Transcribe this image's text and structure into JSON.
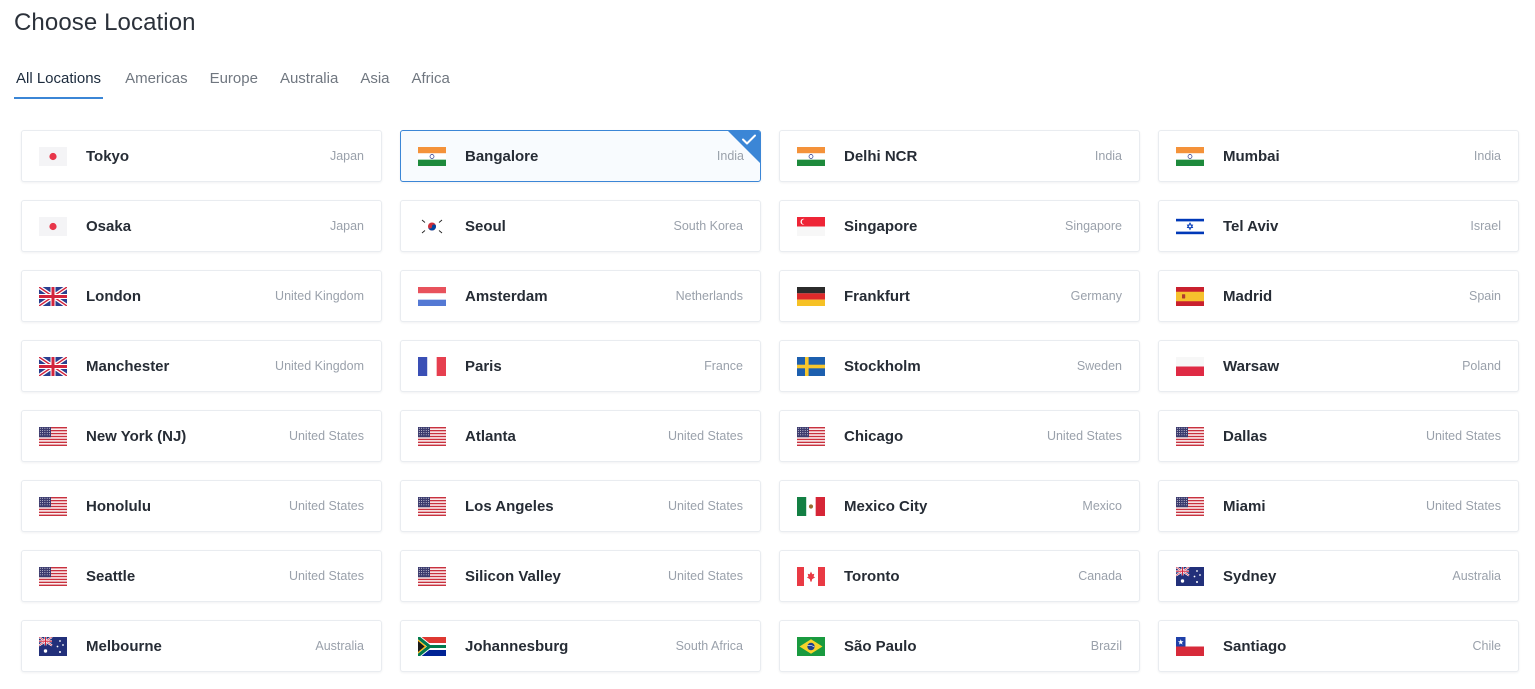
{
  "title": "Choose Location",
  "tabs": [
    {
      "label": "All Locations",
      "active": true
    },
    {
      "label": "Americas",
      "active": false
    },
    {
      "label": "Europe",
      "active": false
    },
    {
      "label": "Australia",
      "active": false
    },
    {
      "label": "Asia",
      "active": false
    },
    {
      "label": "Africa",
      "active": false
    }
  ],
  "selected_city": "Bangalore",
  "accent_color": "#3b86d6",
  "locations": [
    {
      "city": "Tokyo",
      "country": "Japan",
      "flag": "japan-flag-icon"
    },
    {
      "city": "Bangalore",
      "country": "India",
      "flag": "india-flag-icon"
    },
    {
      "city": "Delhi NCR",
      "country": "India",
      "flag": "india-flag-icon"
    },
    {
      "city": "Mumbai",
      "country": "India",
      "flag": "india-flag-icon"
    },
    {
      "city": "Osaka",
      "country": "Japan",
      "flag": "japan-flag-icon"
    },
    {
      "city": "Seoul",
      "country": "South Korea",
      "flag": "south-korea-flag-icon"
    },
    {
      "city": "Singapore",
      "country": "Singapore",
      "flag": "singapore-flag-icon"
    },
    {
      "city": "Tel Aviv",
      "country": "Israel",
      "flag": "israel-flag-icon"
    },
    {
      "city": "London",
      "country": "United Kingdom",
      "flag": "uk-flag-icon"
    },
    {
      "city": "Amsterdam",
      "country": "Netherlands",
      "flag": "netherlands-flag-icon"
    },
    {
      "city": "Frankfurt",
      "country": "Germany",
      "flag": "germany-flag-icon"
    },
    {
      "city": "Madrid",
      "country": "Spain",
      "flag": "spain-flag-icon"
    },
    {
      "city": "Manchester",
      "country": "United Kingdom",
      "flag": "uk-flag-icon"
    },
    {
      "city": "Paris",
      "country": "France",
      "flag": "france-flag-icon"
    },
    {
      "city": "Stockholm",
      "country": "Sweden",
      "flag": "sweden-flag-icon"
    },
    {
      "city": "Warsaw",
      "country": "Poland",
      "flag": "poland-flag-icon"
    },
    {
      "city": "New York (NJ)",
      "country": "United States",
      "flag": "us-flag-icon"
    },
    {
      "city": "Atlanta",
      "country": "United States",
      "flag": "us-flag-icon"
    },
    {
      "city": "Chicago",
      "country": "United States",
      "flag": "us-flag-icon"
    },
    {
      "city": "Dallas",
      "country": "United States",
      "flag": "us-flag-icon"
    },
    {
      "city": "Honolulu",
      "country": "United States",
      "flag": "us-flag-icon"
    },
    {
      "city": "Los Angeles",
      "country": "United States",
      "flag": "us-flag-icon"
    },
    {
      "city": "Mexico City",
      "country": "Mexico",
      "flag": "mexico-flag-icon"
    },
    {
      "city": "Miami",
      "country": "United States",
      "flag": "us-flag-icon"
    },
    {
      "city": "Seattle",
      "country": "United States",
      "flag": "us-flag-icon"
    },
    {
      "city": "Silicon Valley",
      "country": "United States",
      "flag": "us-flag-icon"
    },
    {
      "city": "Toronto",
      "country": "Canada",
      "flag": "canada-flag-icon"
    },
    {
      "city": "Sydney",
      "country": "Australia",
      "flag": "australia-flag-icon"
    },
    {
      "city": "Melbourne",
      "country": "Australia",
      "flag": "australia-flag-icon"
    },
    {
      "city": "Johannesburg",
      "country": "South Africa",
      "flag": "south-africa-flag-icon"
    },
    {
      "city": "São Paulo",
      "country": "Brazil",
      "flag": "brazil-flag-icon"
    },
    {
      "city": "Santiago",
      "country": "Chile",
      "flag": "chile-flag-icon"
    }
  ]
}
